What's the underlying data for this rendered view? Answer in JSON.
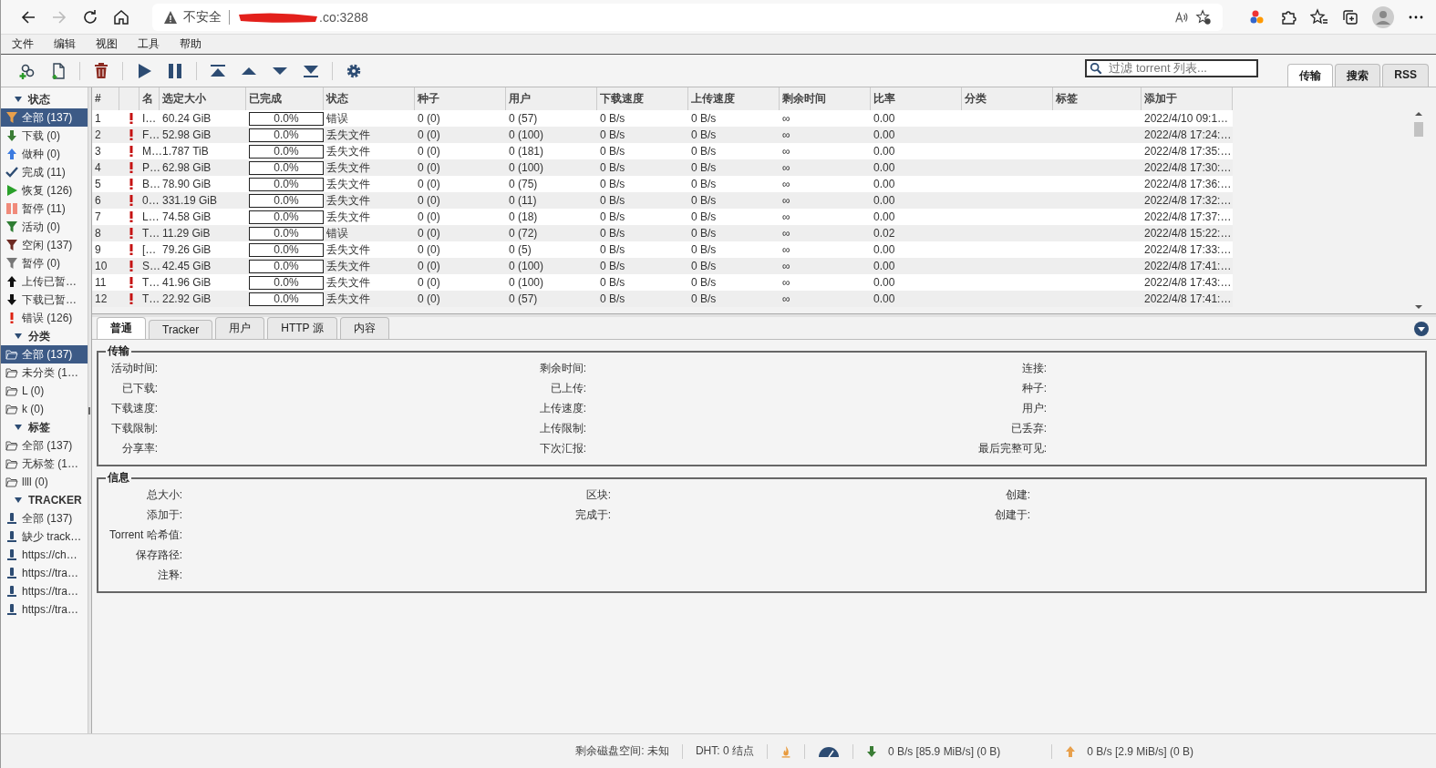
{
  "browser": {
    "security": "不安全",
    "url": ".co:3288"
  },
  "menu": [
    "文件",
    "编辑",
    "视图",
    "工具",
    "帮助"
  ],
  "filter": {
    "placeholder": "过滤 torrent 列表..."
  },
  "view_tabs": [
    {
      "label": "传输",
      "selected": true
    },
    {
      "label": "搜索",
      "selected": false
    },
    {
      "label": "RSS",
      "selected": false
    }
  ],
  "sidebar": [
    {
      "kind": "status",
      "title": "状态",
      "items": [
        {
          "label": "全部 (137)",
          "selected": true
        },
        {
          "label": "下载 (0)",
          "selected": false
        },
        {
          "label": "做种 (0)",
          "selected": false
        },
        {
          "label": "完成 (11)",
          "selected": false
        },
        {
          "label": "恢复 (126)",
          "selected": false
        },
        {
          "label": "暂停 (11)",
          "selected": false
        },
        {
          "label": "活动 (0)",
          "selected": false
        },
        {
          "label": "空闲 (137)",
          "selected": false
        },
        {
          "label": "暂停 (0)",
          "selected": false
        },
        {
          "label": "上传已暂…",
          "selected": false
        },
        {
          "label": "下载已暂…",
          "selected": false
        },
        {
          "label": "错误 (126)",
          "selected": false
        }
      ]
    },
    {
      "kind": "category",
      "title": "分类",
      "items": [
        {
          "label": "全部 (137)",
          "selected": true
        },
        {
          "label": "未分类 (1…",
          "selected": false
        },
        {
          "label": "L (0)",
          "selected": false
        },
        {
          "label": "k (0)",
          "selected": false
        }
      ]
    },
    {
      "kind": "tag",
      "title": "标签",
      "items": [
        {
          "label": "全部 (137)",
          "selected": false
        },
        {
          "label": "无标签 (1…",
          "selected": false
        },
        {
          "label": "llll (0)",
          "selected": false
        }
      ]
    },
    {
      "kind": "tracker",
      "title": "TRACKER",
      "items": [
        {
          "label": "全部 (137)",
          "selected": false
        },
        {
          "label": "缺少 track…",
          "selected": false
        },
        {
          "label": "https://ch…",
          "selected": false
        },
        {
          "label": "https://tra…",
          "selected": false
        },
        {
          "label": "https://tra…",
          "selected": false
        },
        {
          "label": "https://tra…",
          "selected": false
        }
      ]
    }
  ],
  "table": {
    "columns": [
      "#",
      "",
      "名",
      "选定大小",
      "已完成",
      "状态",
      "种子",
      "用户",
      "下载速度",
      "上传速度",
      "剩余时间",
      "比率",
      "分类",
      "标签",
      "添加于"
    ],
    "rows": [
      {
        "num": "1",
        "name": "I…",
        "size": "60.24 GiB",
        "progress": "0.0%",
        "level": 0,
        "status": "错误",
        "seeds": "0 (0)",
        "peers": "0 (57)",
        "down": "0 B/s",
        "up": "0 B/s",
        "eta": "∞",
        "ratio": "0.00",
        "added": "2022/4/10 09:1…"
      },
      {
        "num": "2",
        "name": "F…",
        "size": "52.98 GiB",
        "progress": "0.0%",
        "level": 0,
        "status": "丢失文件",
        "seeds": "0 (0)",
        "peers": "0 (100)",
        "down": "0 B/s",
        "up": "0 B/s",
        "eta": "∞",
        "ratio": "0.00",
        "added": "2022/4/8 17:24:…"
      },
      {
        "num": "3",
        "name": "M…",
        "size": "1.787 TiB",
        "progress": "0.0%",
        "level": 0,
        "status": "丢失文件",
        "seeds": "0 (0)",
        "peers": "0 (181)",
        "down": "0 B/s",
        "up": "0 B/s",
        "eta": "∞",
        "ratio": "0.00",
        "added": "2022/4/8 17:35:…"
      },
      {
        "num": "4",
        "name": "P…",
        "size": "62.98 GiB",
        "progress": "0.0%",
        "level": 0,
        "status": "丢失文件",
        "seeds": "0 (0)",
        "peers": "0 (100)",
        "down": "0 B/s",
        "up": "0 B/s",
        "eta": "∞",
        "ratio": "0.00",
        "added": "2022/4/8 17:30:…"
      },
      {
        "num": "5",
        "name": "B…",
        "size": "78.90 GiB",
        "progress": "0.0%",
        "level": 0,
        "status": "丢失文件",
        "seeds": "0 (0)",
        "peers": "0 (75)",
        "down": "0 B/s",
        "up": "0 B/s",
        "eta": "∞",
        "ratio": "0.00",
        "added": "2022/4/8 17:36:…"
      },
      {
        "num": "6",
        "name": "0…",
        "size": "331.19 GiB",
        "progress": "0.0%",
        "level": 0,
        "status": "丢失文件",
        "seeds": "0 (0)",
        "peers": "0 (11)",
        "down": "0 B/s",
        "up": "0 B/s",
        "eta": "∞",
        "ratio": "0.00",
        "added": "2022/4/8 17:32:…"
      },
      {
        "num": "7",
        "name": "L…",
        "size": "74.58 GiB",
        "progress": "0.0%",
        "level": 0,
        "status": "丢失文件",
        "seeds": "0 (0)",
        "peers": "0 (18)",
        "down": "0 B/s",
        "up": "0 B/s",
        "eta": "∞",
        "ratio": "0.00",
        "added": "2022/4/8 17:37:…"
      },
      {
        "num": "8",
        "name": "T…",
        "size": "11.29 GiB",
        "progress": "0.0%",
        "level": 0,
        "status": "错误",
        "seeds": "0 (0)",
        "peers": "0 (72)",
        "down": "0 B/s",
        "up": "0 B/s",
        "eta": "∞",
        "ratio": "0.02",
        "added": "2022/4/8 15:22:…"
      },
      {
        "num": "9",
        "name": "[…",
        "size": "79.26 GiB",
        "progress": "0.0%",
        "level": 0,
        "status": "丢失文件",
        "seeds": "0 (0)",
        "peers": "0 (5)",
        "down": "0 B/s",
        "up": "0 B/s",
        "eta": "∞",
        "ratio": "0.00",
        "added": "2022/4/8 17:33:…"
      },
      {
        "num": "10",
        "name": "S…",
        "size": "42.45 GiB",
        "progress": "0.0%",
        "level": 0,
        "status": "丢失文件",
        "seeds": "0 (0)",
        "peers": "0 (100)",
        "down": "0 B/s",
        "up": "0 B/s",
        "eta": "∞",
        "ratio": "0.00",
        "added": "2022/4/8 17:41:…"
      },
      {
        "num": "11",
        "name": "T…",
        "size": "41.96 GiB",
        "progress": "0.0%",
        "level": 0,
        "status": "丢失文件",
        "seeds": "0 (0)",
        "peers": "0 (100)",
        "down": "0 B/s",
        "up": "0 B/s",
        "eta": "∞",
        "ratio": "0.00",
        "added": "2022/4/8 17:43:…"
      },
      {
        "num": "12",
        "name": "T…",
        "size": "22.92 GiB",
        "progress": "0.0%",
        "level": 0,
        "status": "丢失文件",
        "seeds": "0 (0)",
        "peers": "0 (57)",
        "down": "0 B/s",
        "up": "0 B/s",
        "eta": "∞",
        "ratio": "0.00",
        "added": "2022/4/8 17:41:…"
      }
    ]
  },
  "detail_tabs": [
    {
      "label": "普通",
      "selected": true
    },
    {
      "label": "Tracker",
      "selected": false
    },
    {
      "label": "用户",
      "selected": false
    },
    {
      "label": "HTTP 源",
      "selected": false
    },
    {
      "label": "内容",
      "selected": false
    }
  ],
  "groups": [
    {
      "title": "传输",
      "rows": [
        [
          "活动时间:",
          "剩余时间:",
          "连接:"
        ],
        [
          "已下载:",
          "已上传:",
          "种子:"
        ],
        [
          "下载速度:",
          "上传速度:",
          "用户:"
        ],
        [
          "下载限制:",
          "上传限制:",
          "已丢弃:"
        ],
        [
          "分享率:",
          "下次汇报:",
          "最后完整可见:"
        ]
      ]
    },
    {
      "title": "信息",
      "rows": [
        [
          "总大小:",
          "区块:",
          "创建:"
        ],
        [
          "添加于:",
          "完成于:",
          "创建于:"
        ],
        [
          "Torrent 哈希值:"
        ],
        [
          "保存路径:"
        ],
        [
          "注释:"
        ]
      ]
    }
  ],
  "status_bar": {
    "disk": "剩余磁盘空间: 未知",
    "dht": "DHT: 0 结点",
    "download": "0 B/s [85.9 MiB/s] (0 B)",
    "upload": "0 B/s [2.9 MiB/s] (0 B)"
  }
}
